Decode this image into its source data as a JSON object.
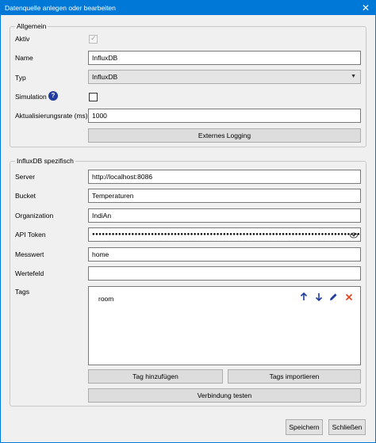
{
  "window": {
    "title": "Datenquelle anlegen oder bearbeiten",
    "close_glyph": "✕"
  },
  "general": {
    "legend": "Allgemein",
    "active_label": "Aktiv",
    "active_checked": true,
    "name_label": "Name",
    "name_value": "InfluxDB",
    "type_label": "Typ",
    "type_value": "InfluxDB",
    "simulation_label": "Simulation",
    "simulation_checked": false,
    "help_glyph": "?",
    "rate_label": "Aktualisierungsrate (ms)",
    "rate_value": "1000",
    "external_logging_label": "Externes Logging"
  },
  "influx": {
    "legend": "InfluxDB spezifisch",
    "server_label": "Server",
    "server_value": "http://localhost:8086",
    "bucket_label": "Bucket",
    "bucket_value": "Temperaturen",
    "org_label": "Organization",
    "org_value": "IndiAn",
    "token_label": "API Token",
    "token_value": "●●●●●●●●●●●●●●●●●●●●●●●●●●●●●●●●●●●●●●●●●●●●●●●●●●●●●●●●●●●●●●●●●●●●●●●●●●●●●●●●●●●●",
    "measurement_label": "Messwert",
    "measurement_value": "home",
    "field_label": "Wertefeld",
    "field_value": "",
    "tags_label": "Tags",
    "tags": [
      {
        "name": "room"
      }
    ],
    "add_tag_label": "Tag hinzufügen",
    "import_tags_label": "Tags importieren",
    "test_connection_label": "Verbindung testen"
  },
  "footer": {
    "save_label": "Speichern",
    "close_label": "Schließen"
  },
  "colors": {
    "titlebar": "#0078d7",
    "accent_icon": "#1f3c9e",
    "delete_icon": "#e0401a"
  }
}
